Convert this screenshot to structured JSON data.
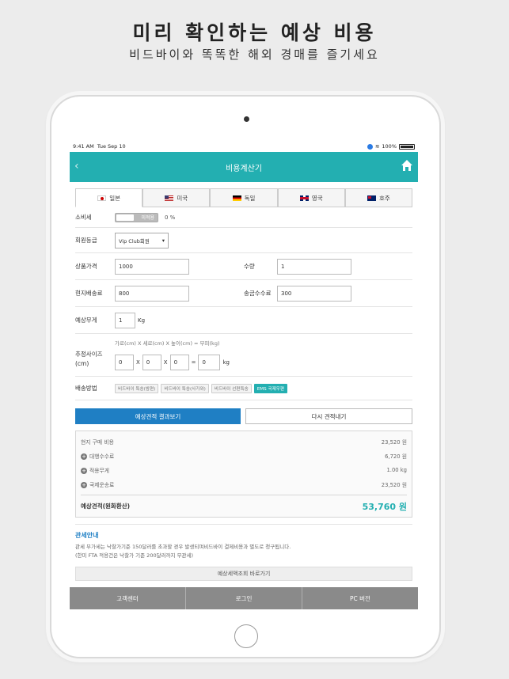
{
  "promo": {
    "title": "미리 확인하는 예상 비용",
    "subtitle": "비드바이와 똑똑한 해외 경매를 즐기세요"
  },
  "statusbar": {
    "time": "9:41 AM",
    "date": "Tue Sep 10",
    "battery": "100%"
  },
  "appbar": {
    "title": "비용계산기",
    "back_icon": "chevron-left-icon",
    "home_icon": "home-icon",
    "color": "#23afb1"
  },
  "tabs": [
    {
      "label": "일본",
      "flag": "jp",
      "active": true
    },
    {
      "label": "미국",
      "flag": "us",
      "active": false
    },
    {
      "label": "독일",
      "flag": "de",
      "active": false
    },
    {
      "label": "영국",
      "flag": "uk",
      "active": false
    },
    {
      "label": "호주",
      "flag": "au",
      "active": false
    }
  ],
  "form": {
    "tax": {
      "label": "소비세",
      "toggle_label": "미적용",
      "value": "0 %"
    },
    "member": {
      "label": "회원등급",
      "selected": "Vip Club회원"
    },
    "price": {
      "label": "상품가격",
      "value": "1000"
    },
    "quantity": {
      "label": "수량",
      "value": "1"
    },
    "local_shipping": {
      "label": "현지배송료",
      "value": "800"
    },
    "remit_fee": {
      "label": "송금수수료",
      "value": "300"
    },
    "weight": {
      "label": "예상무게",
      "value": "1",
      "unit": "Kg"
    },
    "size": {
      "label_line1": "추정사이즈",
      "label_line2": "(cm)",
      "hint": "가로(cm) X 세로(cm) X 높이(cm) = 부피(kg)",
      "width": "0",
      "depth": "0",
      "height": "0",
      "result": "0",
      "x1": "X",
      "x2": "X",
      "eq": "=",
      "unit": "kg"
    },
    "shipping": {
      "label": "배송방법",
      "options": [
        "비드바이 특송(밤편)",
        "비드바이 특송(사가와)",
        "비드바이 선편특송",
        "EMS 국제우편"
      ],
      "active_index": 3
    }
  },
  "buttons": {
    "estimate": "예상견적 결과보기",
    "reset": "다시 견적내기"
  },
  "summary": {
    "purchase": {
      "label": "현지 구매 비용",
      "value": "23,520 원"
    },
    "agency_fee": {
      "label": "대행수수료",
      "value": "6,720 원"
    },
    "weight": {
      "label": "적용무게",
      "value": "1.00 kg"
    },
    "intl_shipping": {
      "label": "국제운송료",
      "value": "23,520 원"
    },
    "total": {
      "label": "예상견적(원화환산)",
      "value": "53,760 원"
    }
  },
  "customs": {
    "title": "관세안내",
    "line1": "관세 부가세는 낙찰가기준 150달러를 초과할 경우 발생되며비드바이 결제비용과 별도로 청구됩니다.",
    "line2": "(한미 FTA 적용건은 낙찰가 기준 200달러까지 무관세)",
    "link": "예상세액조회 바로가기"
  },
  "bottom_nav": [
    "고객센터",
    "로그인",
    "PC 버전"
  ]
}
